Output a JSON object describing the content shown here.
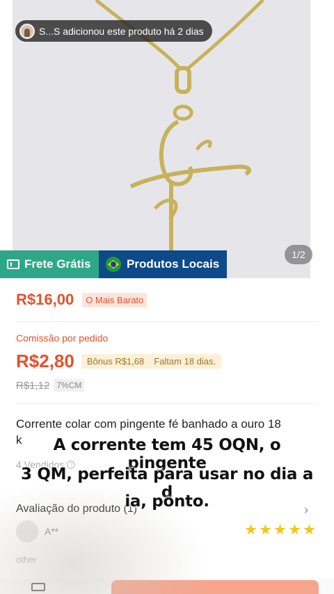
{
  "gallery": {
    "activity_text": "S...S adicionou este produto há 2 dias",
    "counter": "1/2",
    "badge_free": "Frete Grátis",
    "badge_local": "Produtos Locais"
  },
  "pricing": {
    "price": "R$16,00",
    "cheapest_tag": "O Mais Barato",
    "commission_label": "Comissão por pedido",
    "commission": "R$2,80",
    "bonus": "Bônus R$1,68",
    "remaining": "Faltam 18 dias.",
    "old_price": "R$1,12",
    "percent": "7%CM"
  },
  "product": {
    "title_line1": "Corrente colar com pingente fé banhado a ouro 18",
    "title_line2": "k",
    "sold": "4 Vendidos",
    "info_symbol": "?"
  },
  "reviews": {
    "label": "Avaliação do produto (1)",
    "chevron": "›",
    "reviewer": "A**",
    "rating": 5,
    "other_text": "other"
  },
  "caption": {
    "line1": "A corrente tem 45 OQN, o pingente",
    "line2": "3 QM, perfeita para usar no dia a d",
    "line3": "ia, ponto."
  },
  "colors": {
    "price": "#e8502a",
    "free_shipping": "#2ea788",
    "local_products": "#0c4a8a",
    "star": "#f5c518"
  }
}
